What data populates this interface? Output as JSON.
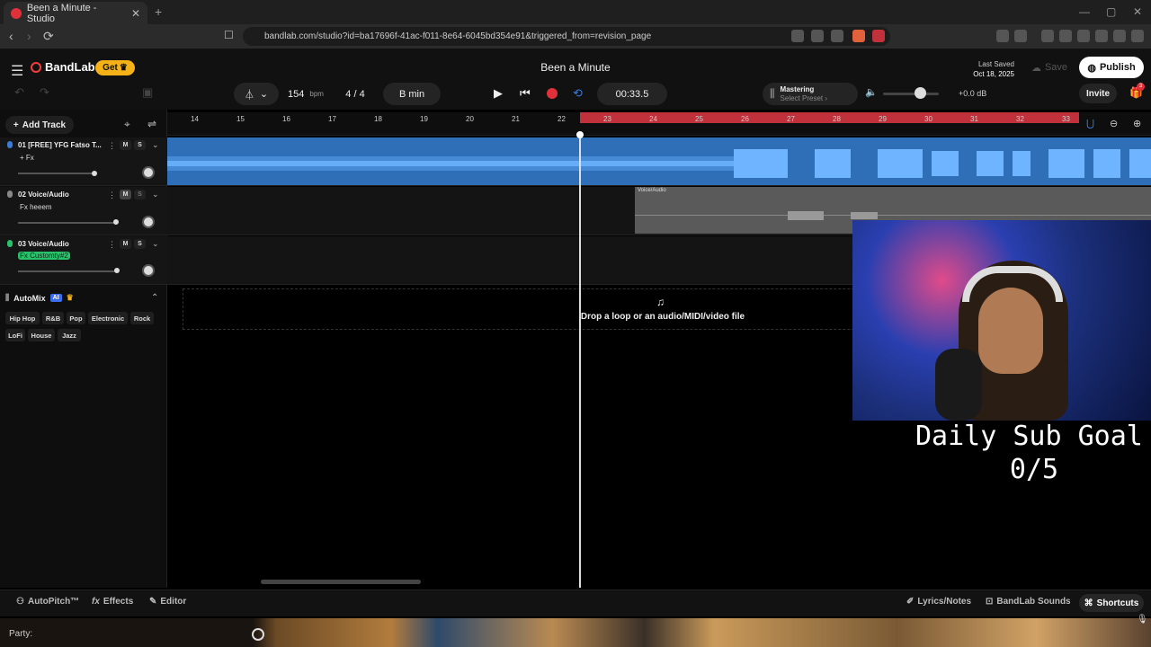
{
  "browser": {
    "tab_title": "Been a Minute - Studio",
    "url": "bandlab.com/studio?id=ba17696f-41ac-f011-8e64-6045bd354e91&triggered_from=revision_page"
  },
  "header": {
    "brand": "BandLab",
    "get_label": "Get",
    "project_title": "Been a Minute",
    "last_saved_label": "Last Saved",
    "last_saved_date": "Oct 18, 2025",
    "save_label": "Save",
    "publish_label": "Publish"
  },
  "transport": {
    "bpm": "154",
    "bpm_unit": "bpm",
    "time_signature": "4 / 4",
    "key": "B min",
    "time": "00:33.5",
    "mastering_label": "Mastering",
    "mastering_preset": "Select Preset",
    "volume_db": "+0.0 dB",
    "volume_level": 0.6,
    "invite_label": "Invite",
    "notification_count": "3"
  },
  "left_panel": {
    "add_track_label": "Add Track",
    "tracks": [
      {
        "name": "01  [FREE] YFG Fatso T...",
        "fx": "+ Fx",
        "color": "#3a7bd5",
        "mute": "M",
        "solo": "S",
        "volume": 0.85
      },
      {
        "name": "02  Voice/Audio",
        "fx": "Fx heeem",
        "color": "#888888",
        "mute": "M",
        "solo": "S",
        "volume": 0.95
      },
      {
        "name": "03  Voice/Audio",
        "fx": "Fx Customty#2",
        "color": "#27c26a",
        "mute": "M",
        "solo": "S",
        "volume": 0.97
      }
    ],
    "automix": {
      "label": "AutoMix",
      "ai_badge": "AI",
      "genres": [
        "Hip Hop",
        "R&B",
        "Pop",
        "Electronic",
        "Rock",
        "LoFi",
        "House",
        "Jazz"
      ]
    }
  },
  "timeline": {
    "bars": [
      "14",
      "15",
      "16",
      "17",
      "18",
      "19",
      "20",
      "21",
      "22",
      "23",
      "24",
      "25",
      "26",
      "27",
      "28",
      "29",
      "30",
      "31",
      "32",
      "33"
    ],
    "clip2_label": "Voice/Audio",
    "drop_text": "Drop a loop or an audio/MIDI/video file"
  },
  "bottom": {
    "autopitch": "AutoPitch™",
    "effects": "Effects",
    "editor": "Editor",
    "lyrics": "Lyrics/Notes",
    "sounds": "BandLab Sounds",
    "shortcuts": "Shortcuts",
    "party": "Party:"
  },
  "overlay": {
    "goal_label": "Daily Sub Goal",
    "goal_count": "0/5"
  }
}
